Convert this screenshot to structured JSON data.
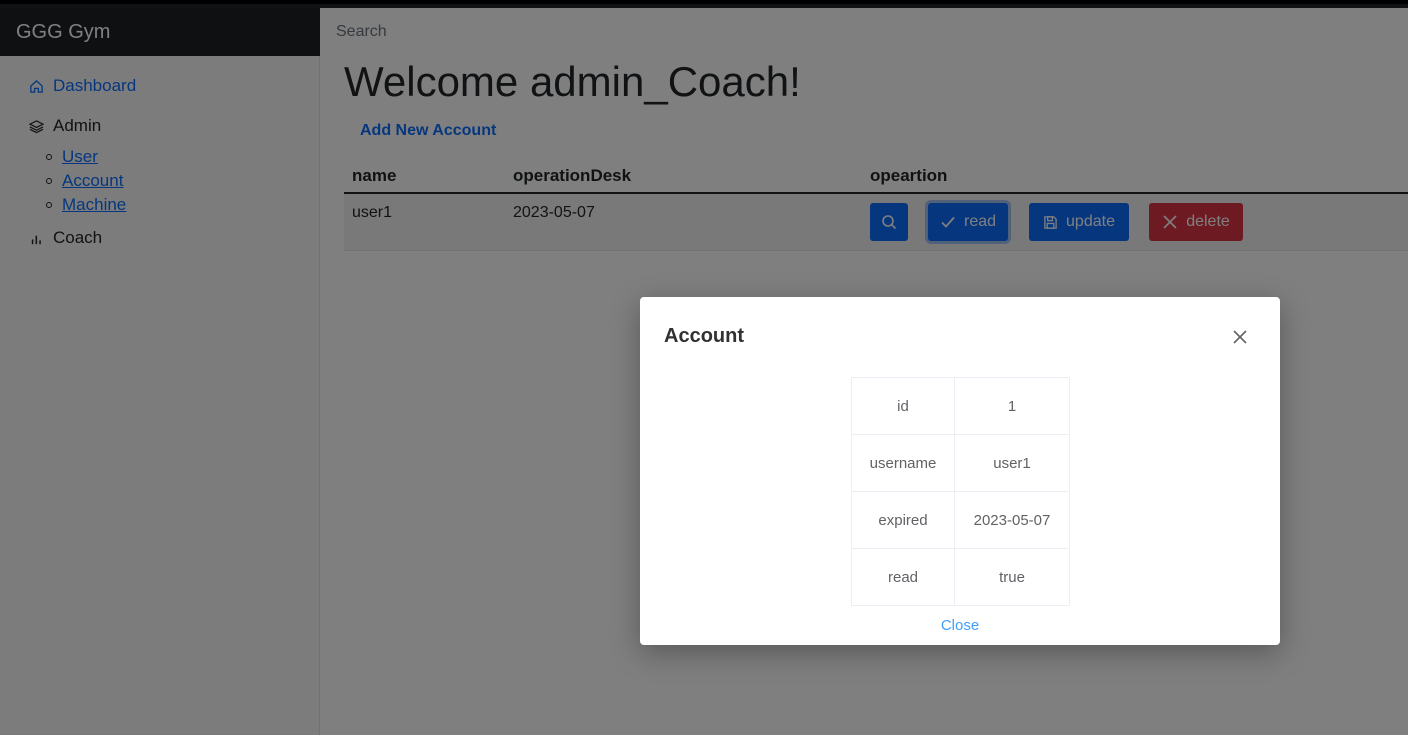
{
  "brand": "GGG Gym",
  "search": {
    "placeholder": "Search"
  },
  "sidebar": {
    "dashboard": "Dashboard",
    "admin": "Admin",
    "admin_items": [
      "User",
      "Account",
      "Machine"
    ],
    "coach": "Coach"
  },
  "main": {
    "welcome": "Welcome admin_Coach!",
    "add_account": "Add New Account",
    "columns": [
      "name",
      "operationDesk",
      "opeartion"
    ],
    "rows": [
      {
        "name": "user1",
        "operationDesk": "2023-05-07"
      }
    ],
    "buttons": {
      "read": "read",
      "update": "update",
      "delete": "delete"
    }
  },
  "modal": {
    "title": "Account",
    "rows": [
      {
        "key": "id",
        "value": "1"
      },
      {
        "key": "username",
        "value": "user1"
      },
      {
        "key": "expired",
        "value": "2023-05-07"
      },
      {
        "key": "read",
        "value": "true"
      }
    ],
    "close": "Close"
  },
  "colors": {
    "primary": "#0d6efd",
    "danger": "#dc3545",
    "dark": "#212529",
    "link": "#409eff"
  },
  "icons": [
    "home-icon",
    "layers-icon",
    "bar-chart-icon",
    "search-icon",
    "check-icon",
    "save-icon",
    "x-icon",
    "close-icon"
  ]
}
